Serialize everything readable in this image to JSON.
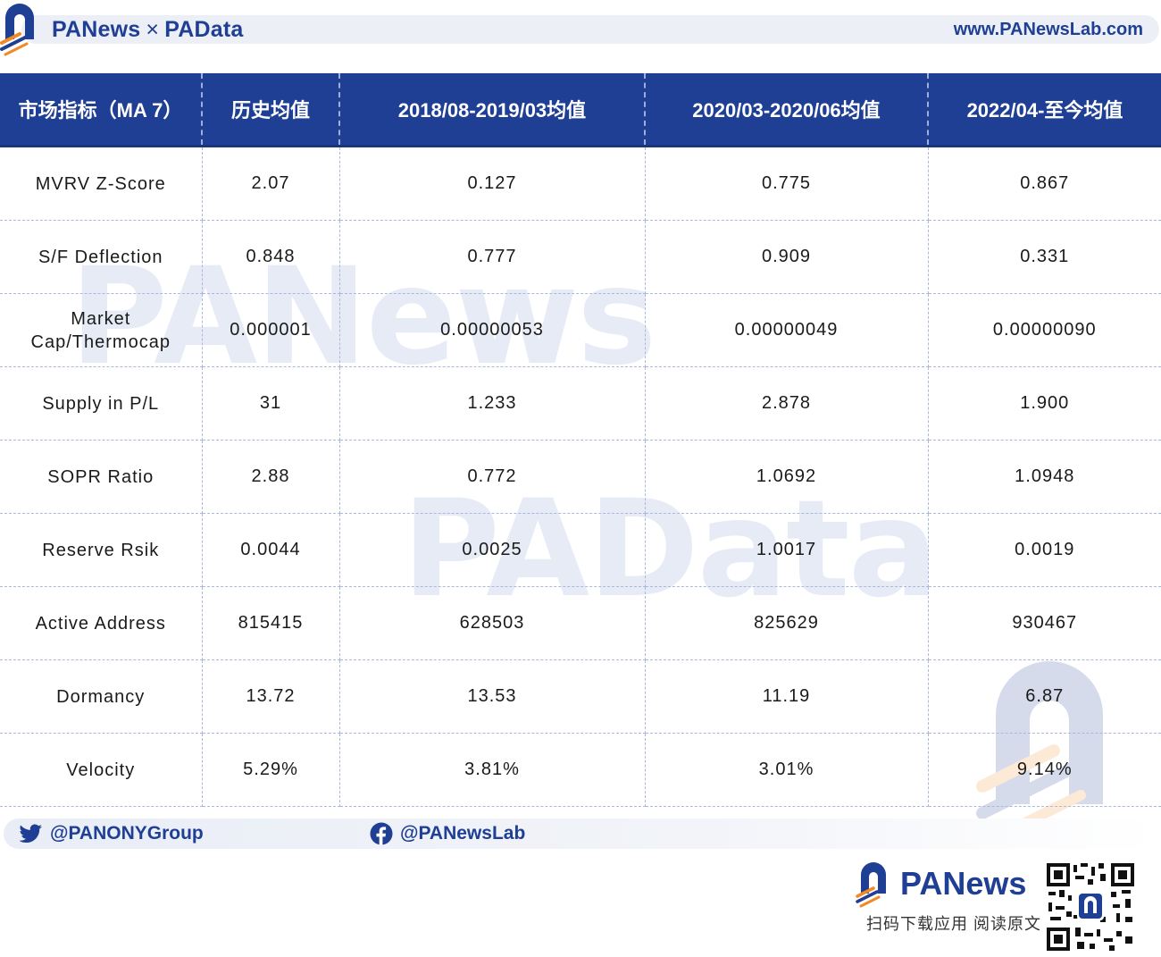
{
  "header": {
    "brand_left": "PANews",
    "brand_sep": "×",
    "brand_right": "PAData",
    "site": "www.PANewsLab.com"
  },
  "watermarks": [
    "PANews",
    "PAData"
  ],
  "table": {
    "columns": [
      "市场指标（MA 7）",
      "历史均值",
      "2018/08-2019/03均值",
      "2020/03-2020/06均值",
      "2022/04-至今均值"
    ],
    "rows": [
      [
        "MVRV Z-Score",
        "2.07",
        "0.127",
        "0.775",
        "0.867"
      ],
      [
        "S/F Deflection",
        "0.848",
        "0.777",
        "0.909",
        "0.331"
      ],
      [
        "Market Cap/Thermocap",
        "0.000001",
        "0.00000053",
        "0.00000049",
        "0.00000090"
      ],
      [
        "Supply in P/L",
        "31",
        "1.233",
        "2.878",
        "1.900"
      ],
      [
        "SOPR Ratio",
        "2.88",
        "0.772",
        "1.0692",
        "1.0948"
      ],
      [
        "Reserve Rsik",
        "0.0044",
        "0.0025",
        "1.0017",
        "0.0019"
      ],
      [
        "Active Address",
        "815415",
        "628503",
        "825629",
        "930467"
      ],
      [
        "Dormancy",
        "13.72",
        "13.53",
        "11.19",
        "6.87"
      ],
      [
        "Velocity",
        "5.29%",
        "3.81%",
        "3.01%",
        "9.14%"
      ]
    ]
  },
  "footer": {
    "twitter": "@PANONYGroup",
    "facebook": "@PANewsLab",
    "brand": "PANews",
    "caption": "扫码下载应用  阅读原文"
  },
  "colors": {
    "brand_blue": "#1f3f94",
    "accent_orange": "#f08a24"
  }
}
